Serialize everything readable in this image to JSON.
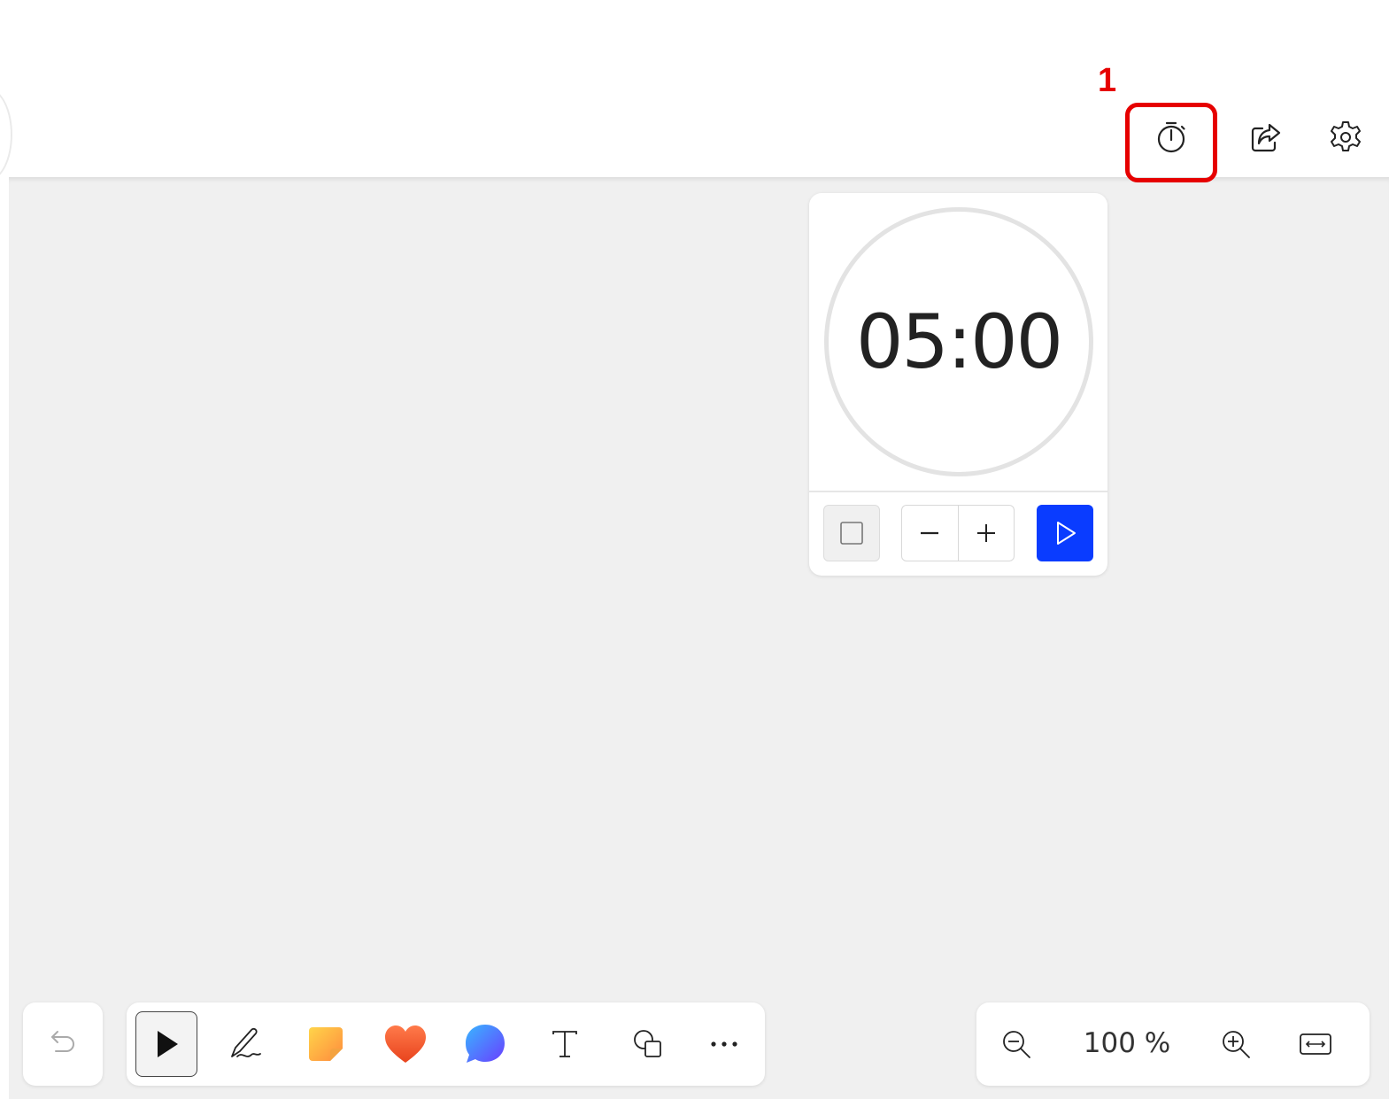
{
  "annotation": {
    "number": "1"
  },
  "header": {
    "icons": [
      "timer-icon",
      "share-icon",
      "settings-icon"
    ]
  },
  "timer": {
    "display": "05:00",
    "controls": {
      "stop_icon": "stop-square-icon",
      "decrease_icon": "minus-icon",
      "increase_icon": "plus-icon",
      "start_icon": "play-icon"
    },
    "colors": {
      "start_button": "#0a3cff",
      "ring": "#e3e3e3"
    }
  },
  "toolbar": {
    "undo_icon": "undo-icon",
    "tools": [
      "select-arrow-icon",
      "pen-icon",
      "sticky-note-icon",
      "heart-reaction-icon",
      "comment-bubble-icon",
      "text-icon",
      "shapes-icon",
      "more-icon"
    ],
    "active_tool": "select-arrow-icon"
  },
  "zoom": {
    "level": "100 %",
    "icons": [
      "zoom-out-icon",
      "zoom-in-icon",
      "fit-width-icon"
    ]
  },
  "colors": {
    "highlight": "#e60000",
    "canvas": "#f0f0f0"
  }
}
